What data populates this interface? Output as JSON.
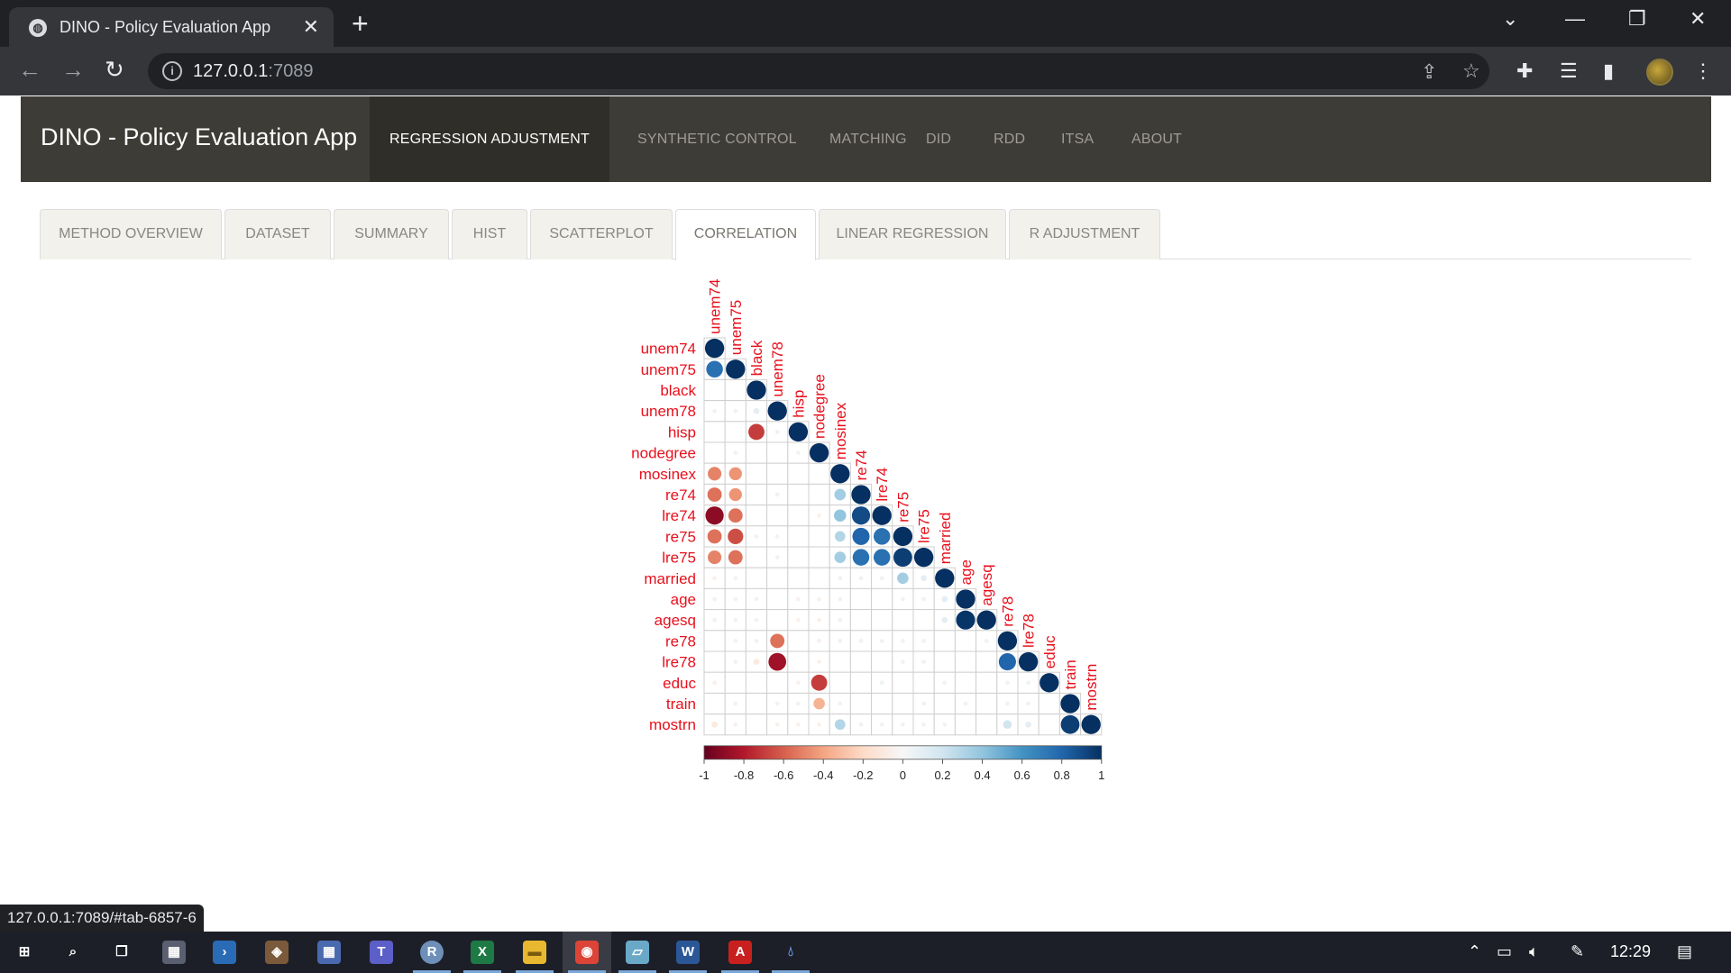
{
  "browser": {
    "tab_title": "DINO - Policy Evaluation App",
    "url_host": "127.0.0.1",
    "url_port": ":7089",
    "status_url": "127.0.0.1:7089/#tab-6857-6"
  },
  "app": {
    "brand": "DINO - Policy Evaluation App",
    "nav": [
      "REGRESSION ADJUSTMENT",
      "SYNTHETIC CONTROL",
      "MATCHING",
      "DID",
      "RDD",
      "ITSA",
      "ABOUT"
    ],
    "nav_active": "REGRESSION ADJUSTMENT",
    "tabs": [
      "METHOD OVERVIEW",
      "DATASET",
      "SUMMARY",
      "HIST",
      "SCATTERPLOT",
      "CORRELATION",
      "LINEAR REGRESSION",
      "R ADJUSTMENT"
    ],
    "tab_active": "CORRELATION"
  },
  "chart_data": {
    "type": "heatmap",
    "style": "corrplot lower-triangle circles",
    "variables": [
      "unem74",
      "unem75",
      "black",
      "unem78",
      "hisp",
      "nodegree",
      "mosinex",
      "re74",
      "lre74",
      "re75",
      "lre75",
      "married",
      "age",
      "agesq",
      "re78",
      "lre78",
      "educ",
      "train",
      "mostrn"
    ],
    "lower_triangle_rows": [
      [
        1
      ],
      [
        0.75,
        1
      ],
      [
        0,
        0,
        1
      ],
      [
        0.05,
        0.05,
        0.1,
        1
      ],
      [
        0,
        0,
        -0.7,
        0.05,
        1
      ],
      [
        0,
        0.05,
        0,
        0,
        0.05,
        1
      ],
      [
        -0.5,
        -0.45,
        0,
        0,
        0,
        0,
        1
      ],
      [
        -0.55,
        -0.45,
        0,
        0.05,
        0,
        0,
        0.35,
        1
      ],
      [
        -0.9,
        -0.55,
        0,
        0,
        0,
        -0.05,
        0.4,
        0.9,
        1
      ],
      [
        -0.55,
        -0.65,
        -0.05,
        0.05,
        0,
        0,
        0.3,
        0.8,
        0.75,
        1
      ],
      [
        -0.5,
        -0.55,
        0,
        0.05,
        0,
        0,
        0.35,
        0.75,
        0.75,
        0.95,
        1
      ],
      [
        -0.05,
        -0.05,
        0,
        0,
        0,
        0,
        0.05,
        0.05,
        0.05,
        0.35,
        0.1,
        1
      ],
      [
        0.05,
        0.05,
        0.05,
        0,
        -0.05,
        -0.05,
        0.05,
        0,
        0,
        0.05,
        0.05,
        0.1,
        1
      ],
      [
        0.05,
        0.05,
        0.05,
        0,
        -0.05,
        -0.05,
        0.05,
        0,
        0,
        0,
        0,
        0.1,
        0.98,
        1
      ],
      [
        0,
        -0.05,
        -0.05,
        -0.55,
        0,
        -0.05,
        0.05,
        0.05,
        0.05,
        0.05,
        0.05,
        0,
        0,
        0.05,
        1
      ],
      [
        0,
        -0.05,
        -0.1,
        -0.85,
        0,
        -0.05,
        0,
        0,
        0,
        0.05,
        0.05,
        0,
        0,
        0,
        0.8,
        1
      ],
      [
        -0.05,
        0,
        0,
        0,
        -0.05,
        -0.7,
        0,
        0,
        0.05,
        0,
        0,
        0.05,
        0,
        0,
        0.05,
        0.05,
        1
      ],
      [
        0,
        -0.05,
        0,
        -0.05,
        -0.05,
        -0.35,
        0.05,
        0,
        0,
        0,
        0.05,
        0,
        0.05,
        0,
        0.05,
        0.05,
        0,
        1
      ],
      [
        -0.1,
        -0.05,
        0,
        -0.05,
        -0.05,
        -0.05,
        0.3,
        0.05,
        0.05,
        0.05,
        0.05,
        0.05,
        0,
        0,
        0.2,
        0.1,
        0,
        0.95,
        1
      ]
    ],
    "colorbar_ticks": [
      "-1",
      "-0.8",
      "-0.6",
      "-0.4",
      "-0.2",
      "0",
      "0.2",
      "0.4",
      "0.6",
      "0.8",
      "1"
    ],
    "colorbar_range": [
      -1,
      1
    ],
    "label_color": "#e8101c",
    "colors": {
      "neg": "#67001f",
      "mid": "#f7f7f7",
      "pos": "#053061"
    }
  },
  "taskbar": {
    "apps": [
      "start-icon",
      "search-icon",
      "task-view-icon",
      "calculator-icon",
      "powershell-icon",
      "photo-app-icon",
      "grid-app-icon",
      "teams-icon",
      "r-icon",
      "excel-icon",
      "file-explorer-icon",
      "chrome-icon",
      "notes-icon",
      "word-icon",
      "acrobat-icon",
      "drop-app-icon"
    ],
    "time": "12:29"
  }
}
